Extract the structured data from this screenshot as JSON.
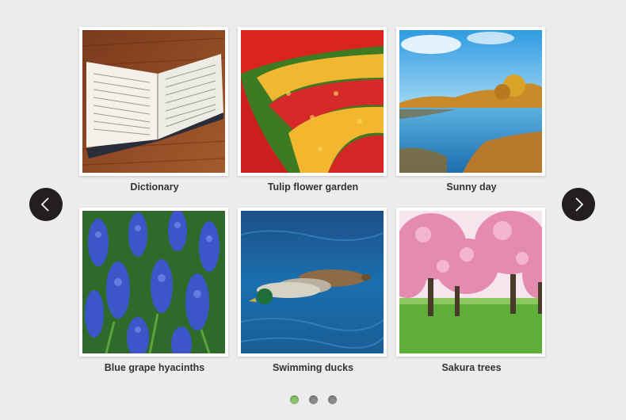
{
  "gallery": {
    "items": [
      {
        "caption": "Dictionary",
        "icon": "open-book-photo"
      },
      {
        "caption": "Tulip flower garden",
        "icon": "tulip-field-photo"
      },
      {
        "caption": "Sunny day",
        "icon": "lake-landscape-photo"
      },
      {
        "caption": "Blue grape hyacinths",
        "icon": "hyacinth-flowers-photo"
      },
      {
        "caption": "Swimming ducks",
        "icon": "ducks-water-photo"
      },
      {
        "caption": "Sakura trees",
        "icon": "cherry-blossom-trees-photo"
      }
    ],
    "prev_icon": "chevron-left-icon",
    "next_icon": "chevron-right-icon",
    "pagination": {
      "pages": 3,
      "active": 1
    },
    "colors": {
      "background": "#ececec",
      "nav_button": "#231f1f",
      "dot": "#8a8a8a",
      "dot_active": "#8cc36a"
    }
  }
}
